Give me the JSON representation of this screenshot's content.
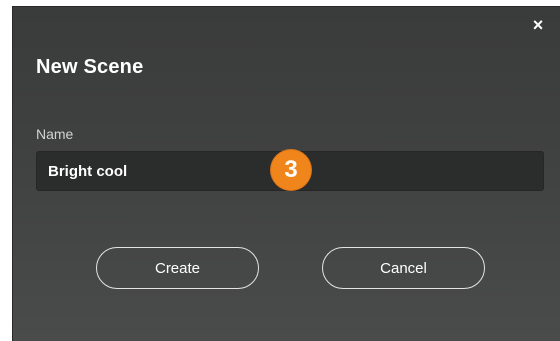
{
  "dialog": {
    "title": "New Scene",
    "close_glyph": "×",
    "close_icon": "close-icon",
    "name_label": "Name",
    "name_value": "Bright cool",
    "create_label": "Create",
    "cancel_label": "Cancel"
  },
  "annotation": {
    "step_number": "3",
    "color": "#f0861b"
  },
  "colors": {
    "dialog_background": "#404141",
    "input_background": "#2b2c2c",
    "text": "#ffffff"
  }
}
